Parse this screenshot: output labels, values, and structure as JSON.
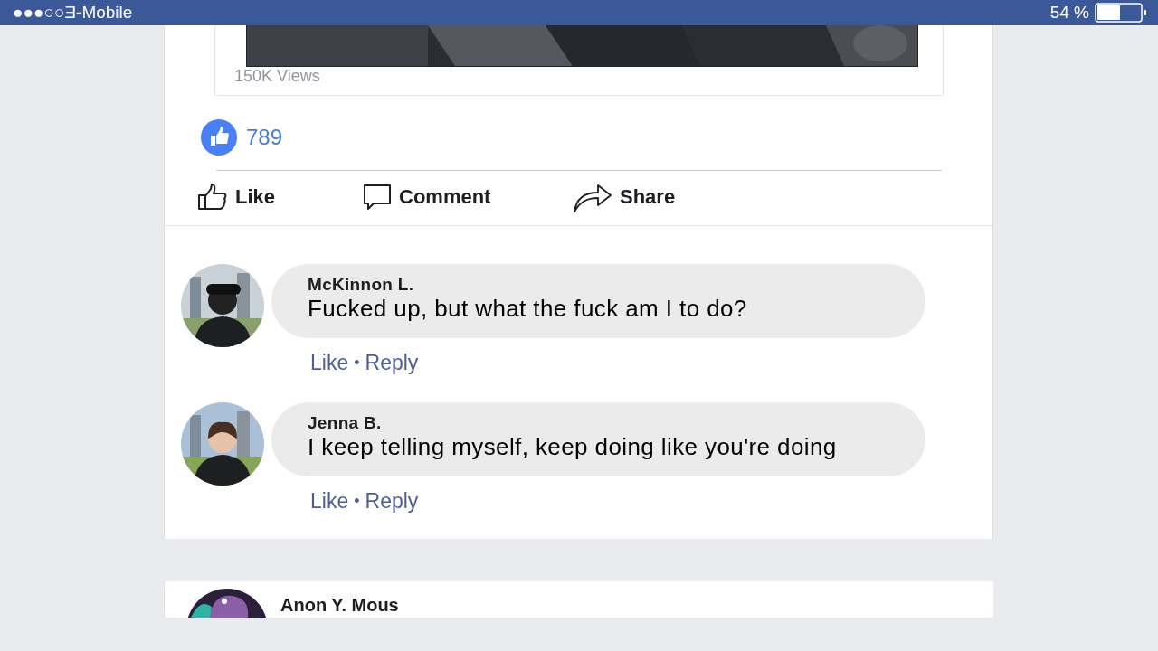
{
  "status_bar": {
    "carrier": "●●●○○Ǝ-Mobile",
    "battery": "54 %"
  },
  "post": {
    "video": {
      "kind": "picture",
      "views": "150K Views"
    },
    "reactions": {
      "count": "789"
    },
    "actions": [
      {
        "kind": "like",
        "label": "Like"
      },
      {
        "kind": "comment",
        "label": "Comment"
      },
      {
        "kind": "share",
        "label": "Share"
      }
    ],
    "comments": [
      {
        "author": "McKinnon L.",
        "text": "Fucked up, but what the fuck am I to do?",
        "like": "Like",
        "separator": "•",
        "reply": "Reply"
      },
      {
        "author": "Jenna B.",
        "text": "I keep telling myself, keep doing like you're doing",
        "like": "Like",
        "separator": "•",
        "reply": "Reply"
      }
    ]
  },
  "next_post": {
    "author": "Anon Y. Mous"
  }
}
